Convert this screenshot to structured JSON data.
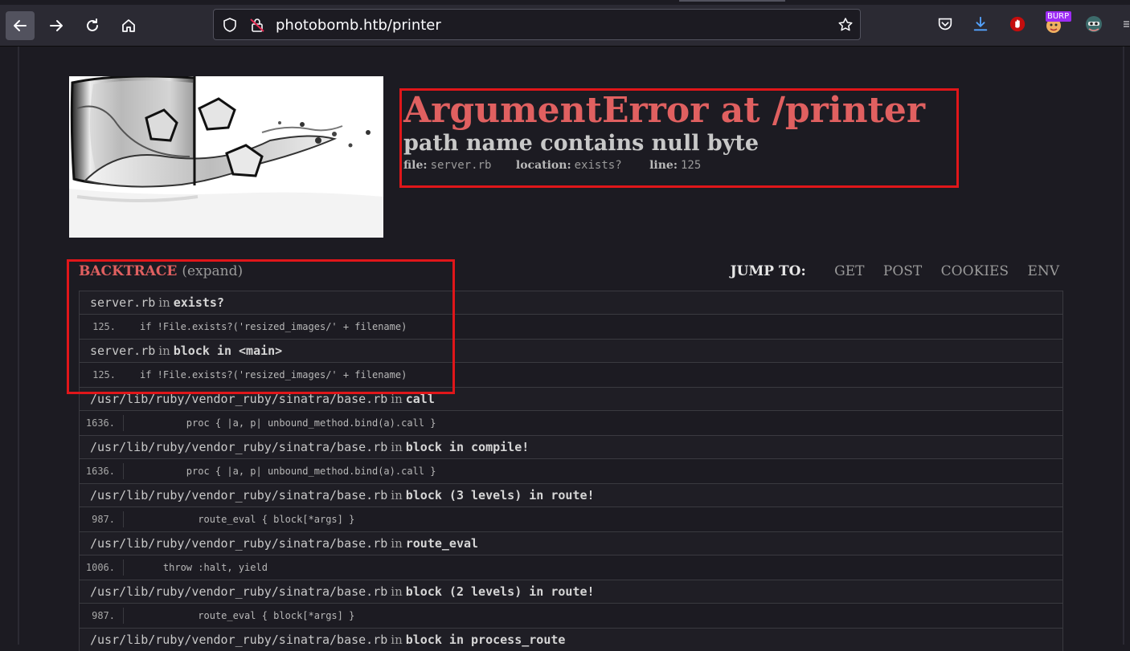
{
  "browser": {
    "url": "photobomb.htb/printer",
    "burp_badge": "BURP"
  },
  "error": {
    "title": "ArgumentError at /printer",
    "message": "path name contains null byte",
    "file_label": "file:",
    "file_value": "server.rb",
    "location_label": "location:",
    "location_value": "exists?",
    "line_label": "line:",
    "line_value": "125"
  },
  "backtrace": {
    "heading": "BACKTRACE",
    "expand": "(expand)",
    "frames": [
      {
        "file": "server.rb",
        "in": "in",
        "func": "exists?",
        "line": "125.",
        "code": "if !File.exists?('resized_images/' + filename)",
        "indent": ""
      },
      {
        "file": "server.rb",
        "in": "in",
        "func": "block in <main>",
        "line": "125.",
        "code": "if !File.exists?('resized_images/' + filename)",
        "indent": ""
      },
      {
        "file": "/usr/lib/ruby/vendor_ruby/sinatra/base.rb",
        "in": "in",
        "func": "call",
        "line": "1636.",
        "code": "proc { |a, p| unbound_method.bind(a).call }",
        "indent": "        "
      },
      {
        "file": "/usr/lib/ruby/vendor_ruby/sinatra/base.rb",
        "in": "in",
        "func": "block in compile!",
        "line": "1636.",
        "code": "proc { |a, p| unbound_method.bind(a).call }",
        "indent": "        "
      },
      {
        "file": "/usr/lib/ruby/vendor_ruby/sinatra/base.rb",
        "in": "in",
        "func": "block (3 levels) in route!",
        "line": "987.",
        "code": "route_eval { block[*args] }",
        "indent": "          "
      },
      {
        "file": "/usr/lib/ruby/vendor_ruby/sinatra/base.rb",
        "in": "in",
        "func": "route_eval",
        "line": "1006.",
        "code": "throw :halt, yield",
        "indent": "    "
      },
      {
        "file": "/usr/lib/ruby/vendor_ruby/sinatra/base.rb",
        "in": "in",
        "func": "block (2 levels) in route!",
        "line": "987.",
        "code": "route_eval { block[*args] }",
        "indent": "          "
      },
      {
        "file": "/usr/lib/ruby/vendor_ruby/sinatra/base.rb",
        "in": "in",
        "func": "block in process_route",
        "line": "",
        "code": "",
        "indent": ""
      }
    ]
  },
  "jump_to": {
    "label": "JUMP TO:",
    "links": [
      "GET",
      "POST",
      "COOKIES",
      "ENV"
    ]
  }
}
